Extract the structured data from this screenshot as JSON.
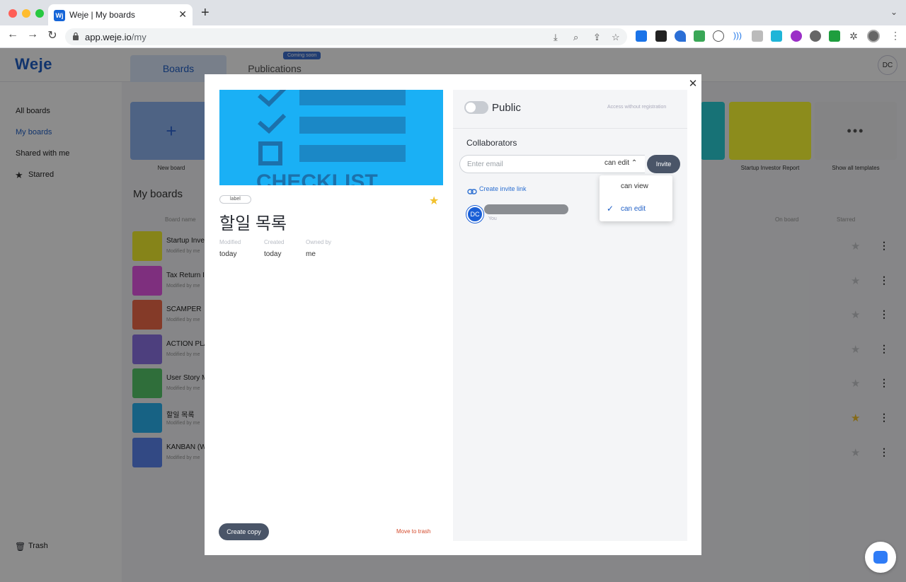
{
  "browser": {
    "tab_title": "Weje | My boards",
    "tab_favicon": "Wj",
    "url_host": "app.weje.io",
    "url_path": "/my"
  },
  "app": {
    "logo": "Weje",
    "tabs": [
      "Boards",
      "Publications"
    ],
    "coming_soon": "Coming soon",
    "user_initials": "DC",
    "sidebar": [
      "All boards",
      "My boards",
      "Shared with me",
      "Starred"
    ],
    "trash": "Trash",
    "templates": [
      {
        "label": "New board",
        "color": "#8fb4f0"
      },
      {
        "label": "Startup Investor Report",
        "color": "#ffff33"
      },
      {
        "label": "Show all templates",
        "color": "#f0f1f3"
      }
    ],
    "my_boards_title": "My boards",
    "columns": [
      "Board name",
      "On board",
      "Starred"
    ],
    "boards": [
      {
        "name": "Startup Inve",
        "modified": "Modified by me",
        "color": "#f5f02e",
        "starred": false
      },
      {
        "name": "Tax Return I",
        "modified": "Modified by me",
        "color": "#e657e6",
        "starred": false
      },
      {
        "name": "SCAMPER",
        "modified": "Modified by me",
        "color": "#f06a4a",
        "starred": false
      },
      {
        "name": "ACTION PLA",
        "modified": "Modified by me",
        "color": "#8c73e6",
        "starred": false
      },
      {
        "name": "User Story M",
        "modified": "Modified by me",
        "color": "#56c86a",
        "starred": false
      },
      {
        "name": "할일 목록",
        "modified": "Modified by me",
        "color": "#2ab3f0",
        "starred": true
      },
      {
        "name": "KANBAN (W",
        "modified": "Modified by me",
        "color": "#5b86f0",
        "starred": false
      }
    ]
  },
  "modal": {
    "preview_text": "CHECKLIST",
    "label": "label",
    "title": "할일 목록",
    "starred": true,
    "meta": [
      {
        "label": "Modified",
        "value": "today"
      },
      {
        "label": "Created",
        "value": "today"
      },
      {
        "label": "Owned by",
        "value": "me"
      }
    ],
    "create_copy": "Create copy",
    "move_to_trash": "Move to trash",
    "public_label": "Public",
    "public_on": false,
    "access_note": "Access without registration",
    "collaborators_title": "Collaborators",
    "email_placeholder": "Enter email",
    "role_selected": "can edit",
    "invite": "Invite",
    "invite_link": "Create invite link",
    "collaborator": {
      "initials": "DC",
      "subtitle": "You"
    },
    "role_options": [
      "can view",
      "can edit"
    ]
  }
}
